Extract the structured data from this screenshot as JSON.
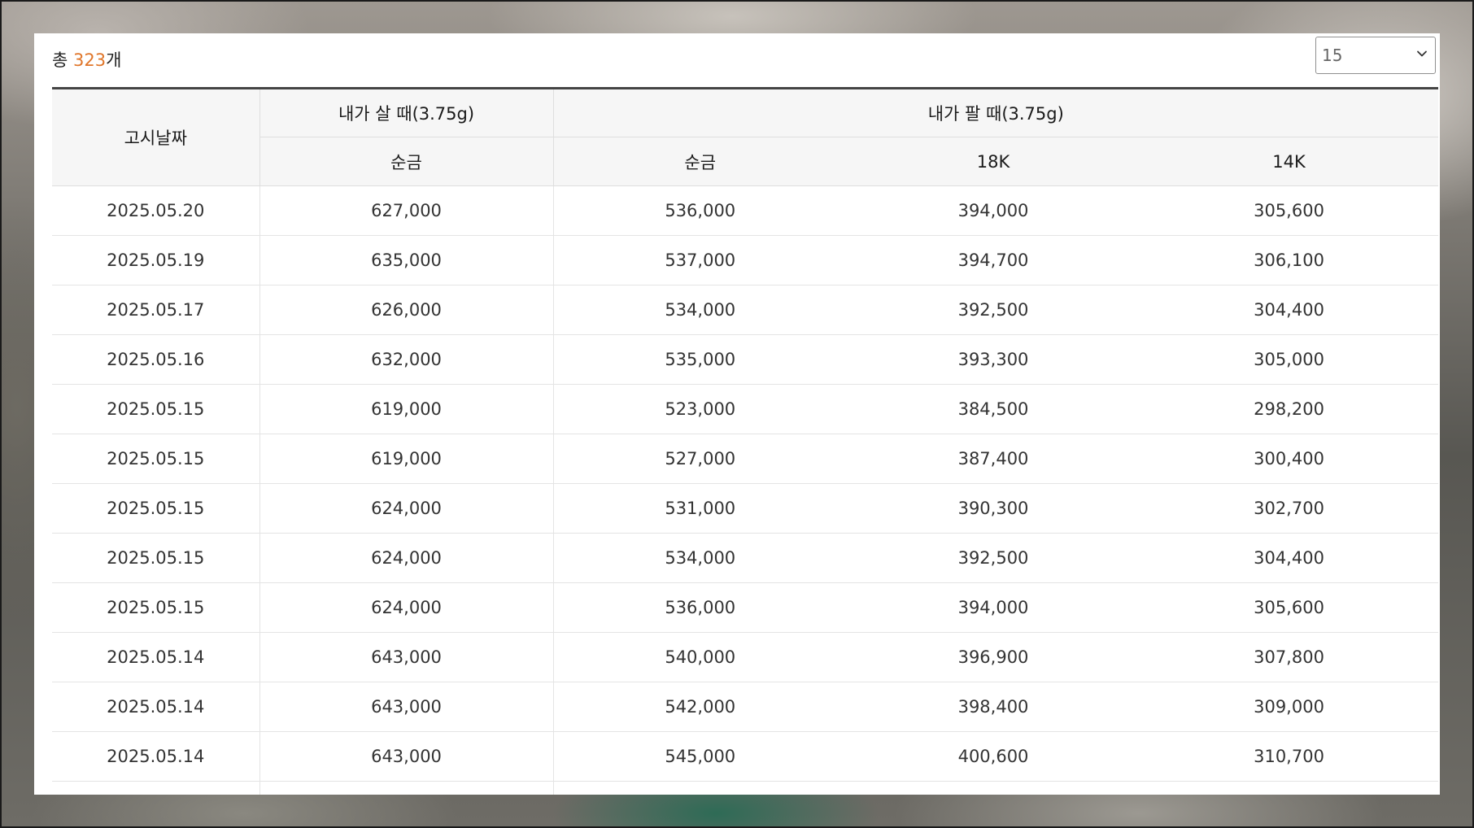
{
  "toolbar": {
    "total_prefix": "총 ",
    "total_count": "323",
    "total_suffix": "개",
    "page_size": {
      "selected": "15",
      "icon": "chevron-down-icon"
    }
  },
  "table": {
    "headers": {
      "date": "고시날짜",
      "buy_group": "내가 살 때(3.75g)",
      "sell_group": "내가 팔 때(3.75g)",
      "buy_pure": "순금",
      "sell_pure": "순금",
      "sell_18k": "18K",
      "sell_14k": "14K"
    },
    "rows": [
      [
        "2025.05.20",
        "627,000",
        "536,000",
        "394,000",
        "305,600"
      ],
      [
        "2025.05.19",
        "635,000",
        "537,000",
        "394,700",
        "306,100"
      ],
      [
        "2025.05.17",
        "626,000",
        "534,000",
        "392,500",
        "304,400"
      ],
      [
        "2025.05.16",
        "632,000",
        "535,000",
        "393,300",
        "305,000"
      ],
      [
        "2025.05.15",
        "619,000",
        "523,000",
        "384,500",
        "298,200"
      ],
      [
        "2025.05.15",
        "619,000",
        "527,000",
        "387,400",
        "300,400"
      ],
      [
        "2025.05.15",
        "624,000",
        "531,000",
        "390,300",
        "302,700"
      ],
      [
        "2025.05.15",
        "624,000",
        "534,000",
        "392,500",
        "304,400"
      ],
      [
        "2025.05.15",
        "624,000",
        "536,000",
        "394,000",
        "305,600"
      ],
      [
        "2025.05.14",
        "643,000",
        "540,000",
        "396,900",
        "307,800"
      ],
      [
        "2025.05.14",
        "643,000",
        "542,000",
        "398,400",
        "309,000"
      ],
      [
        "2025.05.14",
        "643,000",
        "545,000",
        "400,600",
        "310,700"
      ],
      [
        "",
        "",
        "",
        "",
        ""
      ]
    ]
  },
  "colors": {
    "accent_count": "#e0762a",
    "header_bg": "#f6f6f6",
    "header_top_rule": "#444444",
    "row_divider": "#e4e4e4"
  }
}
